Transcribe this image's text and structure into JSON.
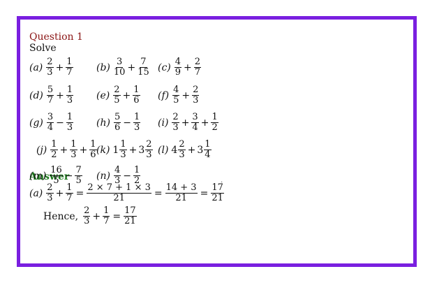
{
  "question": {
    "title": "Question 1",
    "instruction": "Solve",
    "problems": [
      {
        "label": "(a)",
        "parts": [
          {
            "t": "frac",
            "n": "2",
            "d": "3"
          },
          {
            "t": "op",
            "v": "+"
          },
          {
            "t": "frac",
            "n": "1",
            "d": "7"
          }
        ]
      },
      {
        "label": "(b)",
        "parts": [
          {
            "t": "frac",
            "n": "3",
            "d": "10"
          },
          {
            "t": "op",
            "v": "+"
          },
          {
            "t": "frac",
            "n": "7",
            "d": "15"
          }
        ]
      },
      {
        "label": "(c)",
        "parts": [
          {
            "t": "frac",
            "n": "4",
            "d": "9"
          },
          {
            "t": "op",
            "v": "+"
          },
          {
            "t": "frac",
            "n": "2",
            "d": "7"
          }
        ]
      },
      {
        "label": "(d)",
        "parts": [
          {
            "t": "frac",
            "n": "5",
            "d": "7"
          },
          {
            "t": "op",
            "v": "+"
          },
          {
            "t": "frac",
            "n": "1",
            "d": "3"
          }
        ]
      },
      {
        "label": "(e)",
        "parts": [
          {
            "t": "frac",
            "n": "2",
            "d": "5"
          },
          {
            "t": "op",
            "v": "+"
          },
          {
            "t": "frac",
            "n": "1",
            "d": "6"
          }
        ]
      },
      {
        "label": "(f)",
        "parts": [
          {
            "t": "frac",
            "n": "4",
            "d": "5"
          },
          {
            "t": "op",
            "v": "+"
          },
          {
            "t": "frac",
            "n": "2",
            "d": "3"
          }
        ]
      },
      {
        "label": "(g)",
        "parts": [
          {
            "t": "frac",
            "n": "3",
            "d": "4"
          },
          {
            "t": "op",
            "v": "−"
          },
          {
            "t": "frac",
            "n": "1",
            "d": "3"
          }
        ]
      },
      {
        "label": "(h)",
        "parts": [
          {
            "t": "frac",
            "n": "5",
            "d": "6"
          },
          {
            "t": "op",
            "v": "−"
          },
          {
            "t": "frac",
            "n": "1",
            "d": "3"
          }
        ]
      },
      {
        "label": "(i)",
        "parts": [
          {
            "t": "frac",
            "n": "2",
            "d": "3"
          },
          {
            "t": "op",
            "v": "+"
          },
          {
            "t": "frac",
            "n": "3",
            "d": "4"
          },
          {
            "t": "op",
            "v": "+"
          },
          {
            "t": "frac",
            "n": "1",
            "d": "2"
          }
        ]
      },
      {
        "label": "(j)",
        "parts": [
          {
            "t": "frac",
            "n": "1",
            "d": "2"
          },
          {
            "t": "op",
            "v": "+"
          },
          {
            "t": "frac",
            "n": "1",
            "d": "3"
          },
          {
            "t": "op",
            "v": "+"
          },
          {
            "t": "frac",
            "n": "1",
            "d": "6"
          }
        ]
      },
      {
        "label": "(k)",
        "parts": [
          {
            "t": "whole",
            "v": "1"
          },
          {
            "t": "frac",
            "n": "1",
            "d": "3"
          },
          {
            "t": "op",
            "v": "+"
          },
          {
            "t": "whole",
            "v": "3"
          },
          {
            "t": "frac",
            "n": "2",
            "d": "3"
          }
        ]
      },
      {
        "label": "(l)",
        "parts": [
          {
            "t": "whole",
            "v": "4"
          },
          {
            "t": "frac",
            "n": "2",
            "d": "3"
          },
          {
            "t": "op",
            "v": "+"
          },
          {
            "t": "whole",
            "v": "3"
          },
          {
            "t": "frac",
            "n": "1",
            "d": "4"
          }
        ]
      },
      {
        "label": "(m)",
        "parts": [
          {
            "t": "frac",
            "n": "16",
            "d": "5"
          },
          {
            "t": "op",
            "v": "−"
          },
          {
            "t": "frac",
            "n": "7",
            "d": "5"
          }
        ]
      },
      {
        "label": "(n)",
        "parts": [
          {
            "t": "frac",
            "n": "4",
            "d": "3"
          },
          {
            "t": "op",
            "v": "−"
          },
          {
            "t": "frac",
            "n": "1",
            "d": "2"
          }
        ]
      }
    ]
  },
  "answer": {
    "title": "Answer",
    "label": "(a)",
    "line1": [
      {
        "t": "frac",
        "n": "2",
        "d": "3"
      },
      {
        "t": "op",
        "v": "+"
      },
      {
        "t": "frac",
        "n": "1",
        "d": "7"
      },
      {
        "t": "eq",
        "v": "="
      },
      {
        "t": "frac",
        "n": "2 × 7 + 1 × 3",
        "d": "21"
      },
      {
        "t": "eq",
        "v": "="
      },
      {
        "t": "frac",
        "n": "14 + 3",
        "d": "21"
      },
      {
        "t": "eq",
        "v": "="
      },
      {
        "t": "frac",
        "n": "17",
        "d": "21"
      }
    ],
    "hence_label": "Hence,",
    "line2": [
      {
        "t": "frac",
        "n": "2",
        "d": "3"
      },
      {
        "t": "op",
        "v": "+"
      },
      {
        "t": "frac",
        "n": "1",
        "d": "7"
      },
      {
        "t": "eq",
        "v": "="
      },
      {
        "t": "frac",
        "n": "17",
        "d": "21"
      }
    ]
  },
  "colors": {
    "border": "#7a1fe0",
    "question_title": "#8a1414",
    "answer_title": "#1c7a1c"
  }
}
